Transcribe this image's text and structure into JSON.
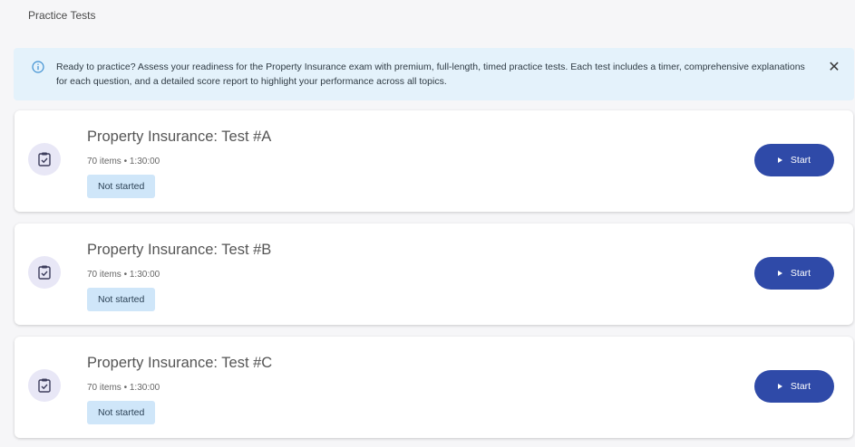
{
  "page": {
    "title": "Practice Tests"
  },
  "banner": {
    "icon": "info-icon",
    "text": "Ready to practice? Assess your readiness for the Property Insurance exam with premium, full-length, timed practice tests. Each test includes a timer, comprehensive explanations for each question, and a detailed score report to highlight your performance across all topics.",
    "close_label": "✕",
    "background": "#e4f2fb"
  },
  "tests": [
    {
      "title": "Property Insurance: Test #A",
      "meta": "70 items • 1:30:00",
      "status": "Not started",
      "start_label": "Start",
      "icon": "clipboard-check-icon"
    },
    {
      "title": "Property Insurance: Test #B",
      "meta": "70 items • 1:30:00",
      "status": "Not started",
      "start_label": "Start",
      "icon": "clipboard-check-icon"
    },
    {
      "title": "Property Insurance: Test #C",
      "meta": "70 items • 1:30:00",
      "status": "Not started",
      "start_label": "Start",
      "icon": "clipboard-check-icon"
    }
  ],
  "colors": {
    "accent": "#2f4aa8",
    "badge": "#cfe6f9",
    "icon_circle": "#e8e7f6"
  }
}
